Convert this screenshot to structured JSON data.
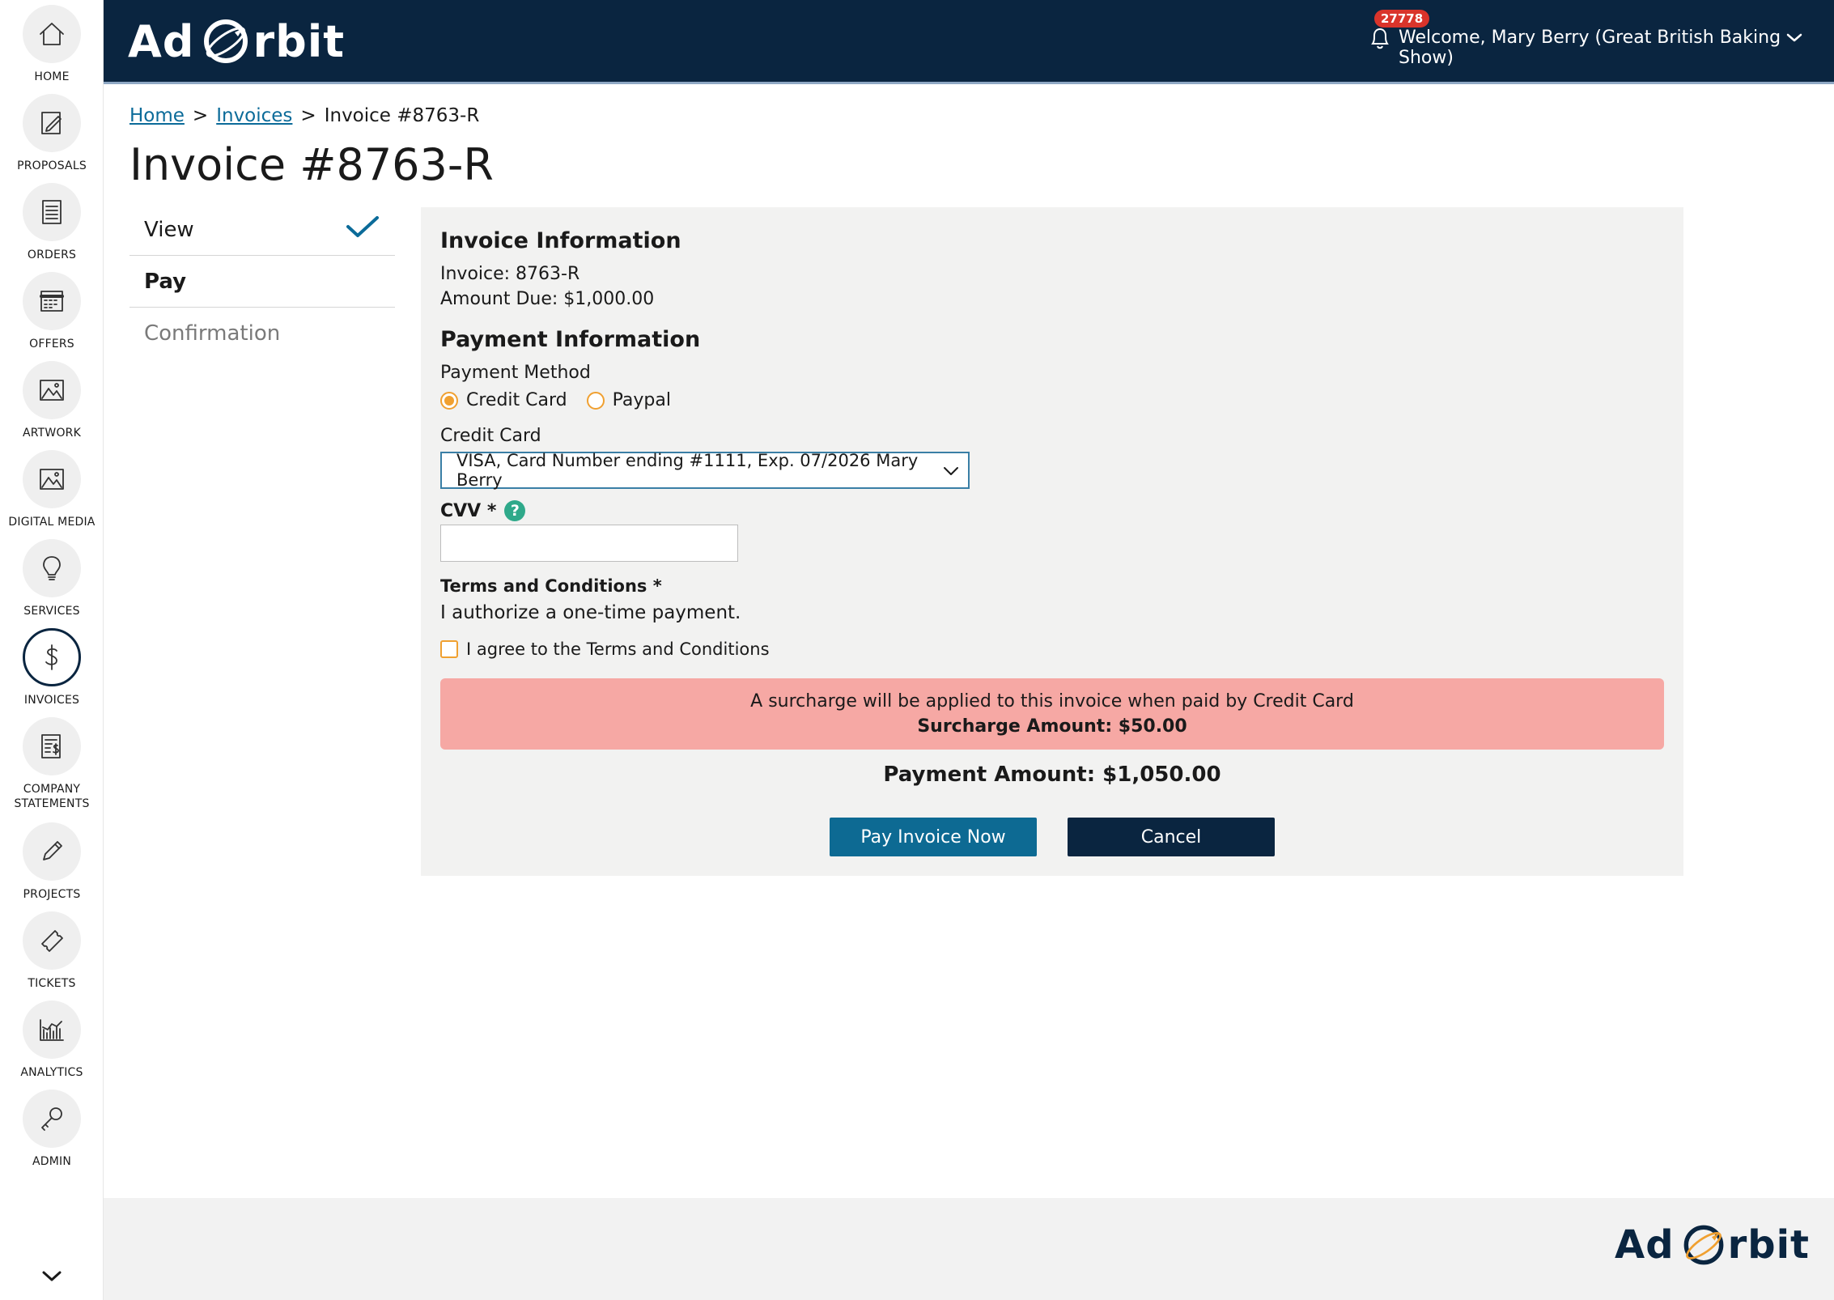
{
  "brand": {
    "logo_text_left": "Ad",
    "logo_text_right": "rbit",
    "header_bg": "#0a2540",
    "accent": "#0d6a93",
    "radio_accent": "#f0a030",
    "alert_bg": "#f6a8a4"
  },
  "sidebar": {
    "items": [
      {
        "label": "HOME",
        "icon": "home-icon"
      },
      {
        "label": "PROPOSALS",
        "icon": "proposals-icon"
      },
      {
        "label": "ORDERS",
        "icon": "orders-icon"
      },
      {
        "label": "OFFERS",
        "icon": "calendar-icon"
      },
      {
        "label": "ARTWORK",
        "icon": "image-icon"
      },
      {
        "label": "DIGITAL MEDIA",
        "icon": "image-icon"
      },
      {
        "label": "SERVICES",
        "icon": "lightbulb-icon"
      },
      {
        "label": "INVOICES",
        "icon": "dollar-icon"
      },
      {
        "label": "COMPANY",
        "label2": "STATEMENTS",
        "icon": "statement-icon"
      },
      {
        "label": "PROJECTS",
        "icon": "pencil-icon"
      },
      {
        "label": "TICKETS",
        "icon": "ticket-icon"
      },
      {
        "label": "ANALYTICS",
        "icon": "analytics-icon"
      },
      {
        "label": "ADMIN",
        "icon": "key-icon"
      }
    ]
  },
  "header": {
    "notification_count": "27778",
    "welcome": "Welcome, Mary Berry (Great British Baking Show)"
  },
  "breadcrumb": {
    "home": "Home",
    "invoices": "Invoices",
    "current": "Invoice #8763-R",
    "separator": ">"
  },
  "page_title": "Invoice #8763-R",
  "steps": {
    "view": "View",
    "pay": "Pay",
    "confirmation": "Confirmation"
  },
  "invoice_info": {
    "title": "Invoice Information",
    "invoice_line": "Invoice: 8763-R",
    "amount_due_line": "Amount Due: $1,000.00"
  },
  "payment_info": {
    "title": "Payment Information",
    "method_label": "Payment Method",
    "option_credit": "Credit Card",
    "option_paypal": "Paypal",
    "card_label": "Credit Card",
    "card_selected": "VISA, Card Number ending #1111, Exp. 07/2026 Mary Berry",
    "cvv_label": "CVV *",
    "cvv_value": "",
    "terms_title": "Terms and Conditions *",
    "terms_text": "I authorize a one-time payment.",
    "agree_label": "I agree to the Terms and Conditions"
  },
  "surcharge": {
    "message": "A surcharge will be applied to this invoice when paid by Credit Card",
    "amount": "Surcharge Amount: $50.00"
  },
  "payment_amount": "Payment Amount: $1,050.00",
  "buttons": {
    "pay": "Pay Invoice Now",
    "cancel": "Cancel"
  }
}
